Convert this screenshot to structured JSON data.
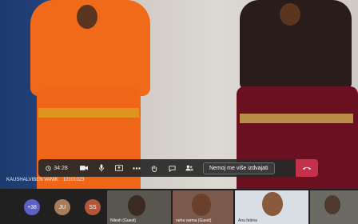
{
  "call": {
    "timer": "34:28",
    "stop_spotlight_label": "Nemoj me više izdvajati",
    "presenter_name": "KAUSHALVIBEN VANIK",
    "presenter_number": "10101023"
  },
  "toolbar_icons": [
    "clock-icon",
    "camera-icon",
    "mic-icon",
    "share-icon",
    "more-icon",
    "raise-hand-icon",
    "chat-icon",
    "people-icon",
    "hang-up-icon"
  ],
  "participants": {
    "overflow_count": "+38",
    "avatars": [
      "JU",
      "SS"
    ],
    "thumbnails": [
      {
        "name": "Nilesh (Guest)"
      },
      {
        "name": "neha varma (Guest)"
      },
      {
        "name": "Ana fatima"
      },
      {
        "name": ""
      }
    ]
  },
  "colors": {
    "accent": "#5b5fc7",
    "hangup": "#c4314b",
    "toolbar": "#282828"
  }
}
